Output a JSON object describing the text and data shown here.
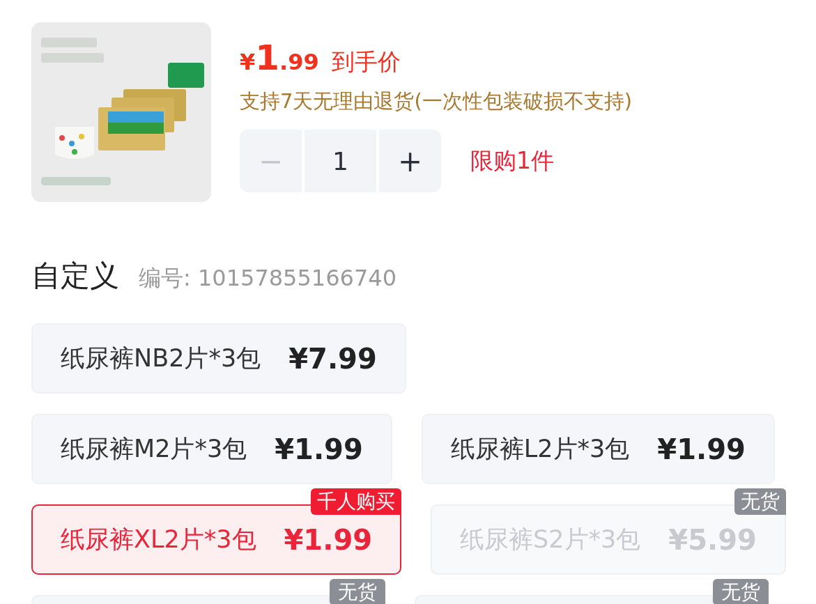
{
  "product": {
    "price": {
      "currency": "¥",
      "integer": "1",
      "decimal": ".99",
      "label": "到手价"
    },
    "policy": "支持7天无理由退货(一次性包装破损不支持)",
    "stepper": {
      "minus": "−",
      "value": "1",
      "plus": "+",
      "minus_disabled": true
    },
    "limit": "限购1件"
  },
  "spec": {
    "title": "自定义",
    "code": "编号: 10157855166740"
  },
  "option_rows": [
    [
      {
        "label": "纸尿裤NB2片*3包",
        "price": "¥7.99",
        "selected": false,
        "disabled": false
      }
    ],
    [
      {
        "label": "纸尿裤M2片*3包",
        "price": "¥1.99",
        "selected": false,
        "disabled": false
      },
      {
        "label": "纸尿裤L2片*3包",
        "price": "¥1.99",
        "selected": false,
        "disabled": false
      }
    ],
    [
      {
        "label": "纸尿裤XL2片*3包",
        "price": "¥1.99",
        "selected": true,
        "disabled": false,
        "badge": {
          "text": "千人购买",
          "kind": "hot"
        }
      },
      {
        "label": "纸尿裤S2片*3包",
        "price": "¥5.99",
        "selected": false,
        "disabled": true,
        "badge": {
          "text": "无货",
          "kind": "sold_out"
        }
      }
    ],
    [
      {
        "selected": false,
        "badge": {
          "text": "无货",
          "kind": "sold_out"
        }
      },
      {
        "selected": false,
        "badge": {
          "text": "无货",
          "kind": "sold_out"
        }
      }
    ]
  ]
}
